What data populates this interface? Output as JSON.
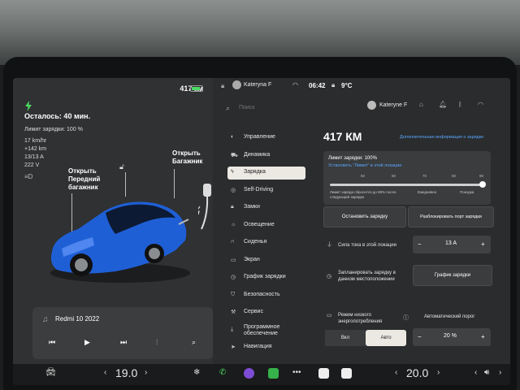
{
  "left": {
    "range": "417 км",
    "remaining": "Осталось: 40 мин.",
    "limit": "Лимит зарядки: 100 %",
    "stats": [
      "17 km/hr",
      "+142 km",
      "13/13 A",
      "222 V"
    ],
    "front_trunk": "Открыть Передний багажник",
    "rear_trunk": "Открыть Багажник",
    "car_color": "#1f5fd6",
    "media": {
      "title": "Redmi 10 2022"
    }
  },
  "status": {
    "user": "Kateryna F",
    "time": "06:42",
    "temp": "9°C"
  },
  "toolbar": {
    "search_placeholder": "Поиск",
    "user": "Kateryne F"
  },
  "menu": [
    {
      "label": "Управление",
      "icon": "toggle-icon"
    },
    {
      "label": "Динамика",
      "icon": "car-icon"
    },
    {
      "label": "Зарядка",
      "icon": "bolt-icon",
      "active": true
    },
    {
      "label": "Self-Driving",
      "icon": "steering-icon"
    },
    {
      "label": "Замки",
      "icon": "lock-icon"
    },
    {
      "label": "Освещение",
      "icon": "sun-icon"
    },
    {
      "label": "Сиденья",
      "icon": "seat-icon"
    },
    {
      "label": "Экран",
      "icon": "screen-icon"
    },
    {
      "label": "График зарядки",
      "icon": "clock-icon"
    },
    {
      "label": "Безопасность",
      "icon": "shield-icon"
    },
    {
      "label": "Сервис",
      "icon": "wrench-icon"
    },
    {
      "label": "Программное обеспечение",
      "icon": "download-icon"
    },
    {
      "label": "Навигация",
      "icon": "nav-icon"
    }
  ],
  "charge": {
    "range": "417 КМ",
    "more_info": "Дополнительная информация о зарядке",
    "limit_title": "Лимит зарядки: 100%",
    "limit_link": "Установить \"Лимит\" в этой локации",
    "ticks": [
      "50",
      "60",
      "70",
      "80",
      "90"
    ],
    "limit_value": 100,
    "note_left": "Лимит заряда сбросится до 80% после следующей зарядки",
    "note_mid": "Ежедневно",
    "note_right": "Поездка",
    "stop_button": "Остановить зарядку",
    "unlock_port_button": "Разблокировать порт зарядки",
    "current_label": "Сила тока в этой локации",
    "current_value": "13 A",
    "schedule_label": "Запланировать зарядку в данном местоположении",
    "schedule_button": "График зарядки",
    "low_power_label": "Режим низкого энергопотребления",
    "auto_threshold_label": "Автоматический порог",
    "seg_on": "Вкл",
    "seg_auto": "Авто",
    "threshold_value": "20 %"
  },
  "bottom": {
    "temp_left": "19.0",
    "temp_right": "20.0"
  },
  "colors": {
    "accent": "#5aa7ff",
    "charge_green": "#4cd964"
  }
}
